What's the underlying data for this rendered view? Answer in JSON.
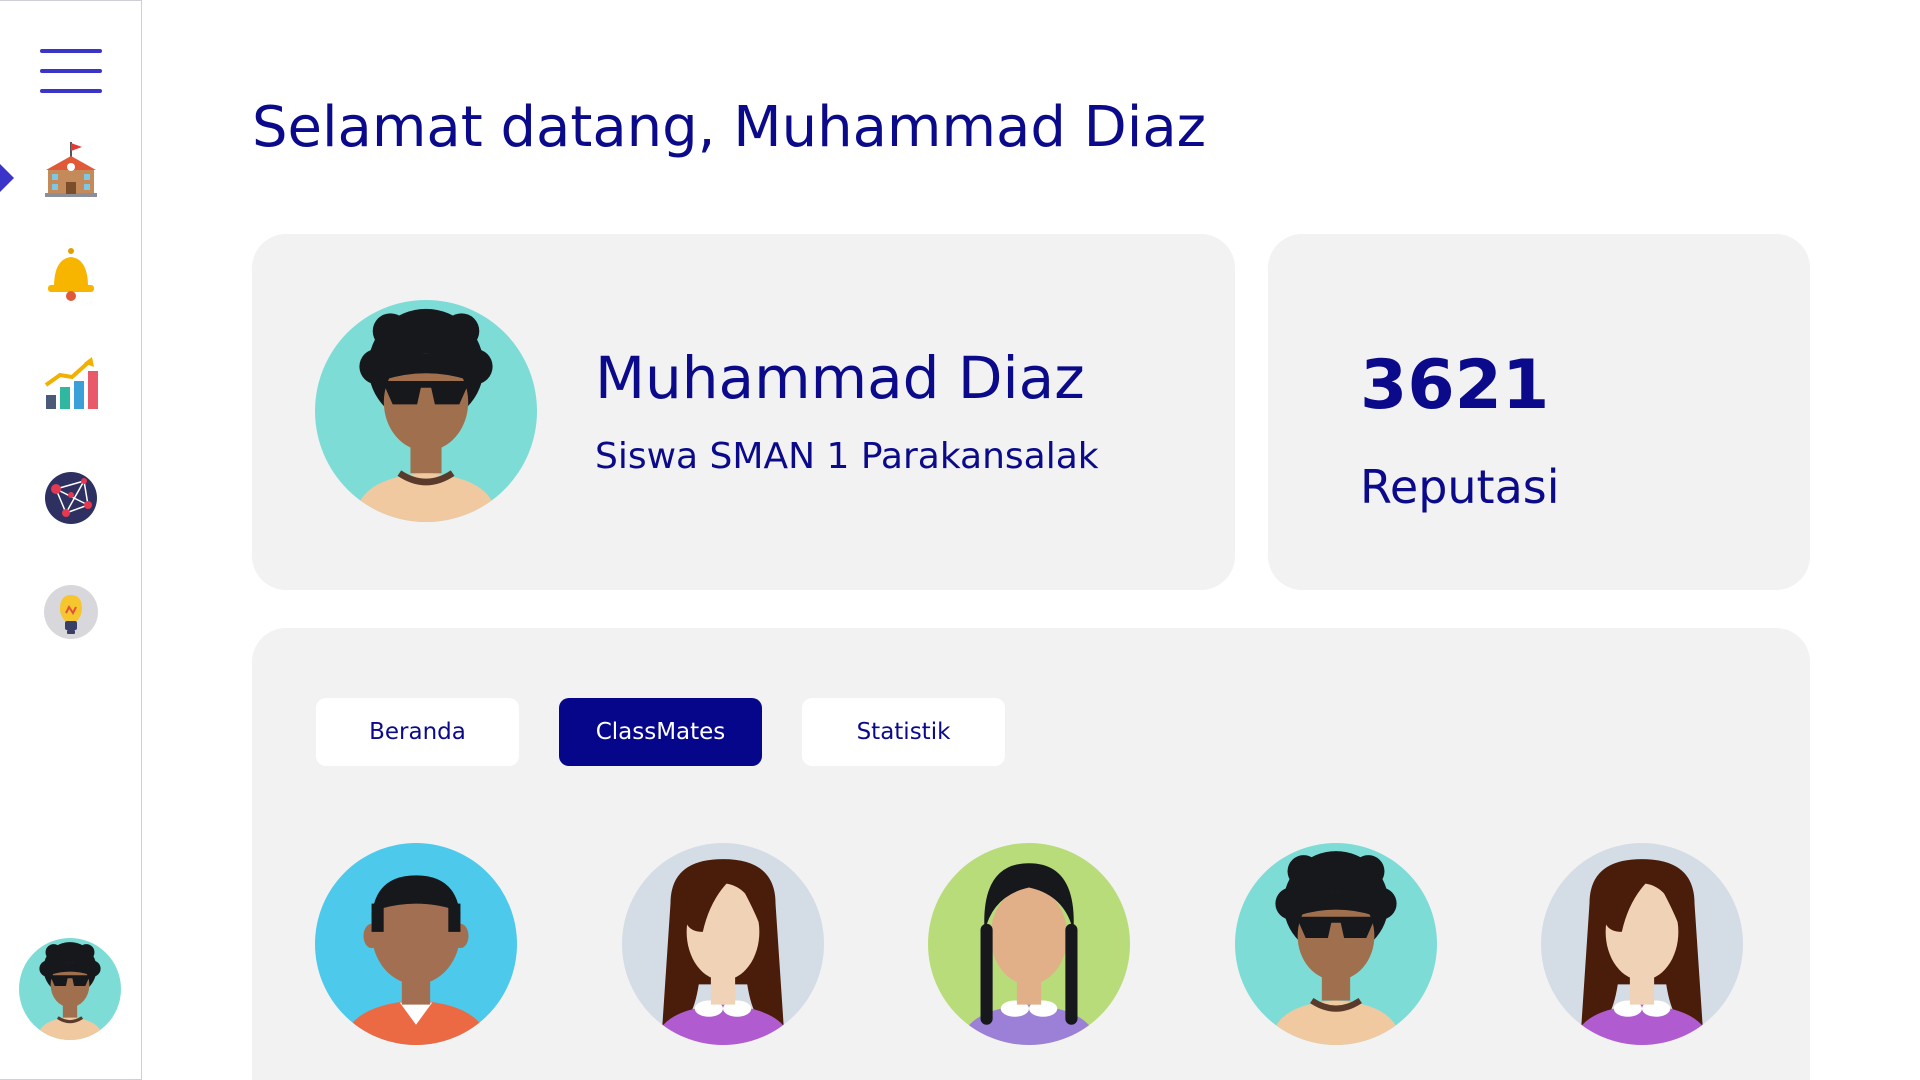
{
  "header": {
    "greeting": "Selamat datang, Muhammad Diaz"
  },
  "sidebar": {
    "menu_icon": "hamburger-menu-icon",
    "items": [
      {
        "icon": "school-icon",
        "active": true
      },
      {
        "icon": "bell-icon",
        "active": false
      },
      {
        "icon": "chart-growth-icon",
        "active": false
      },
      {
        "icon": "network-globe-icon",
        "active": false
      },
      {
        "icon": "lightbulb-icon",
        "active": false
      }
    ],
    "user_avatar": "user-avatar-icon"
  },
  "profile": {
    "name": "Muhammad Diaz",
    "school": "Siswa SMAN 1 Parakansalak"
  },
  "reputation": {
    "value": "3621",
    "label": "Reputasi"
  },
  "tabs": [
    {
      "label": "Beranda",
      "active": false
    },
    {
      "label": "ClassMates",
      "active": true
    },
    {
      "label": "Statistik",
      "active": false
    }
  ],
  "classmates": [
    {
      "avatar": "boy-short-hair-avatar"
    },
    {
      "avatar": "girl-long-hair-avatar"
    },
    {
      "avatar": "girl-braids-avatar"
    },
    {
      "avatar": "boy-curly-sunglasses-avatar"
    },
    {
      "avatar": "girl-long-hair-avatar"
    }
  ],
  "colors": {
    "primary": "#0a0a8a",
    "accent": "#3b34c9",
    "card_bg": "#f2f2f2",
    "active_tab": "#06068a"
  }
}
